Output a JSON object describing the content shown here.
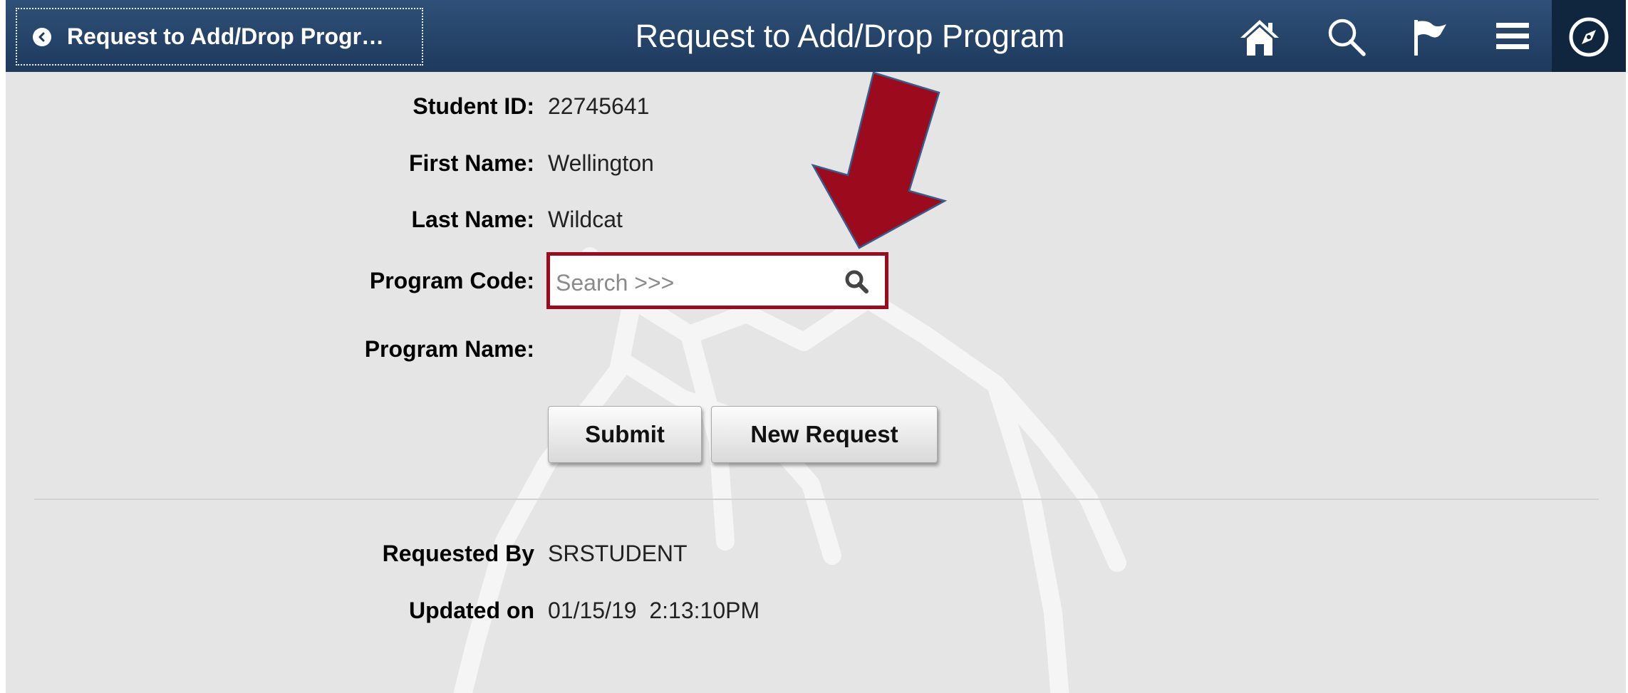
{
  "header": {
    "back_label": "Request to Add/Drop Progr…",
    "title": "Request to Add/Drop Program",
    "nav_icons": [
      "home-icon",
      "search-icon",
      "flag-icon",
      "menu-icon",
      "compass-icon"
    ]
  },
  "form": {
    "student_id": {
      "label": "Student ID:",
      "value": "22745641"
    },
    "first_name": {
      "label": "First Name:",
      "value": "Wellington"
    },
    "last_name": {
      "label": "Last Name:",
      "value": "Wildcat"
    },
    "program_code": {
      "label": "Program Code:",
      "placeholder": "Search >>>"
    },
    "program_name": {
      "label": "Program Name:",
      "value": ""
    }
  },
  "buttons": {
    "submit": "Submit",
    "new_request": "New Request"
  },
  "footer": {
    "requested_by": {
      "label": "Requested By",
      "value": "SRSTUDENT"
    },
    "updated_on": {
      "label": "Updated on",
      "value": "01/15/19  2:13:10PM"
    }
  },
  "colors": {
    "header_bg": "#1e3a5d",
    "highlight": "#9b0a1d",
    "page_bg": "#e5e5e5"
  }
}
